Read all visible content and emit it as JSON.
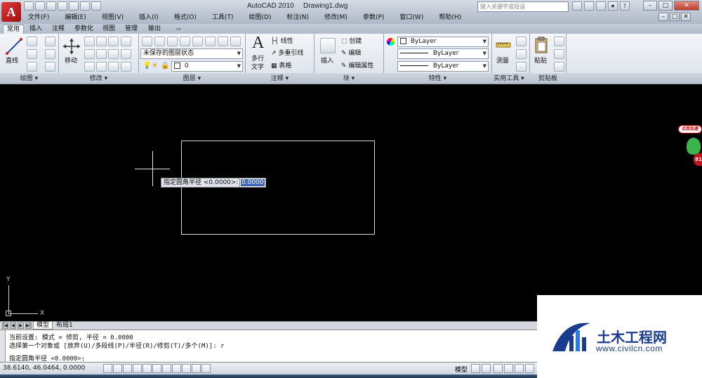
{
  "window": {
    "app_name": "AutoCAD 2010",
    "file_name": "Drawing1.dwg",
    "search_placeholder": "键入关键字或短语",
    "app_logo": "A"
  },
  "menu": [
    "文件(F)",
    "编辑(E)",
    "视图(V)",
    "插入(I)",
    "格式(O)",
    "工具(T)",
    "绘图(D)",
    "标注(N)",
    "修改(M)",
    "参数(P)",
    "窗口(W)",
    "帮助(H)"
  ],
  "ribbon_tabs": [
    "常用",
    "插入",
    "注释",
    "参数化",
    "视图",
    "管理",
    "输出"
  ],
  "ribbon": {
    "draw_line": "直线",
    "modify_move": "移动",
    "layer_state": "未保存的图层状态",
    "layer_current": "0",
    "text_multiline": "多行",
    "text_label": "文字",
    "linetype_label": "线性",
    "multileader_label": "多重引线",
    "table_label": "表格",
    "insert_label": "插入",
    "block_create": "创建",
    "block_edit": "编辑",
    "block_edit_attr": "编辑属性",
    "prop_color": "ByLayer",
    "prop_linetype": "ByLayer",
    "prop_lineweight": "ByLayer",
    "measure_label": "测量",
    "paste_label": "粘贴"
  },
  "panels": [
    "绘图",
    "修改",
    "图层",
    "注释",
    "块",
    "特性",
    "实用工具",
    "剪贴板"
  ],
  "canvas": {
    "prompt": "指定圆角半径 <0.0000>:",
    "input_value": "0.0000",
    "ucs_x": "X",
    "ucs_y": "Y",
    "side_badge": "点我加速",
    "side_badge_num": "81"
  },
  "layout_tabs": [
    "模型",
    "布局1"
  ],
  "command": {
    "line1": "当前设置: 模式 = 修剪, 半径 = 0.0000",
    "line2": "选择第一个对象或 [放弃(U)/多段线(P)/半径(R)/修剪(T)/多个(M)]: r",
    "line3": "指定圆角半径 <0.0000>:"
  },
  "status": {
    "coords": "38.6140,  46.0464,  0.0000",
    "model_label": "模型"
  },
  "watermark": {
    "title": "土木工程网",
    "url": "www.civilcn.com"
  },
  "colors": {
    "background": "#000000",
    "accent_red": "#c0171b",
    "watermark_blue": "#1b3b8f"
  }
}
